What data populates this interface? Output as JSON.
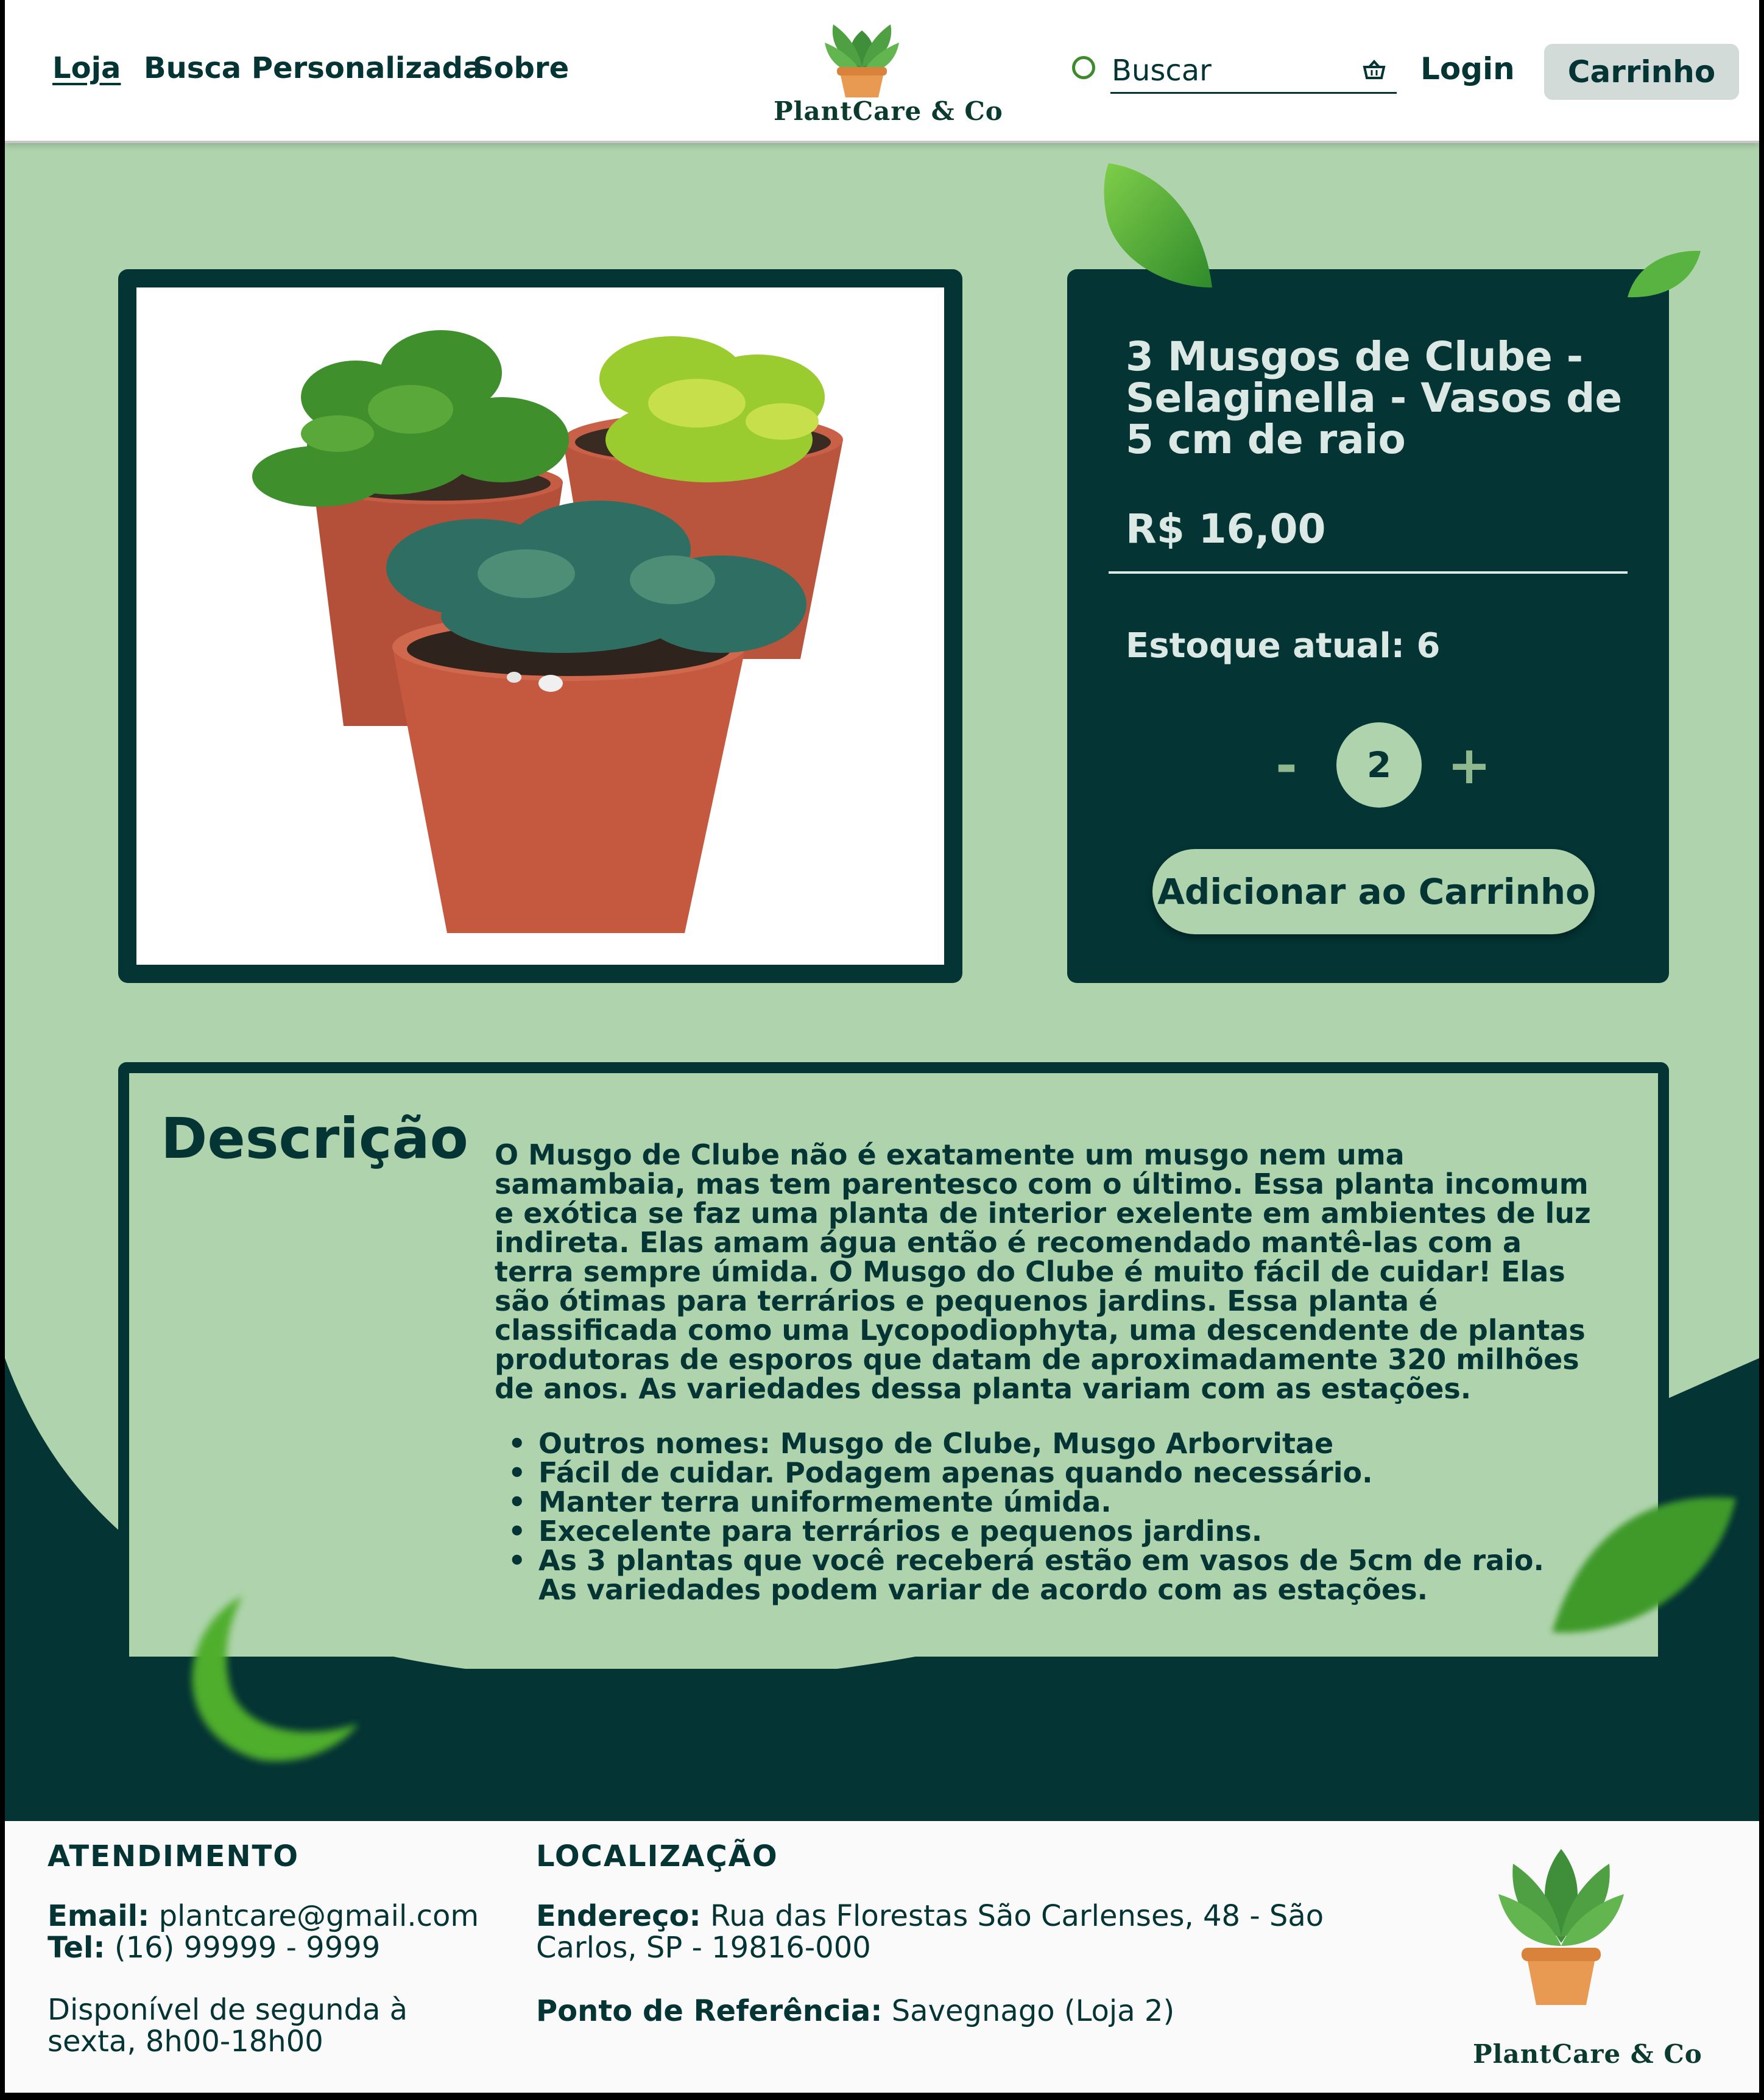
{
  "colors": {
    "dark_green": "#043434",
    "light_green": "#afd4ad",
    "leaf_green": "#5aa33f",
    "pot_orange": "#e89a52"
  },
  "header": {
    "nav": {
      "loja": "Loja",
      "busca": "Busca Personalizada",
      "sobre": "Sobre"
    },
    "logo_text": "PlantCare & Co",
    "search_placeholder": "Buscar",
    "login": "Login",
    "cart": "Carrinho"
  },
  "product": {
    "title": "3 Musgos de Clube - Selaginella - Vasos de 5 cm de raio",
    "price": "R$ 16,00",
    "stock": "Estoque atual: 6",
    "qty_minus": "-",
    "quantity": "2",
    "qty_plus": "+",
    "add_to_cart": "Adicionar ao Carrinho",
    "image_icon": "potted-moss-photo"
  },
  "description": {
    "heading": "Descrição",
    "text": "O Musgo de Clube não é exatamente um musgo nem uma samambaia, mas tem parentesco com o último. Essa planta incomum e exótica se faz uma planta de interior exelente em ambientes de luz indireta. Elas amam água então é recomendado mantê-las com a terra sempre úmida. O Musgo do Clube é muito fácil de cuidar! Elas são ótimas para terrários e pequenos jardins. Essa planta é classificada como uma Lycopodiophyta, uma descendente de plantas produtoras de esporos que datam de aproximadamente 320 milhões de anos. As variedades dessa planta variam com as estações.",
    "bullets": [
      "Outros nomes: Musgo de Clube, Musgo Arborvitae",
      "Fácil de cuidar. Podagem apenas quando necessário.",
      "Manter terra uniformemente úmida.",
      "Execelente para terrários e pequenos jardins.",
      "As 3 plantas que você receberá estão em vasos de 5cm de raio. As variedades podem variar de acordo com as estações."
    ]
  },
  "footer": {
    "atendimento": {
      "heading": "ATENDIMENTO",
      "email_label": "Email:",
      "email": "plantcare@gmail.com",
      "tel_label": "Tel:",
      "tel": "(16) 99999 - 9999",
      "hours": "Disponível de segunda à sexta, 8h00-18h00"
    },
    "localizacao": {
      "heading": "LOCALIZAÇÃO",
      "address_label": "Endereço:",
      "address": "Rua das Florestas São Carlenses, 48   - São Carlos, SP - 19816-000",
      "ref_label": "Ponto de Referência:",
      "ref": "Savegnago (Loja 2)"
    },
    "logo_text": "PlantCare & Co"
  }
}
